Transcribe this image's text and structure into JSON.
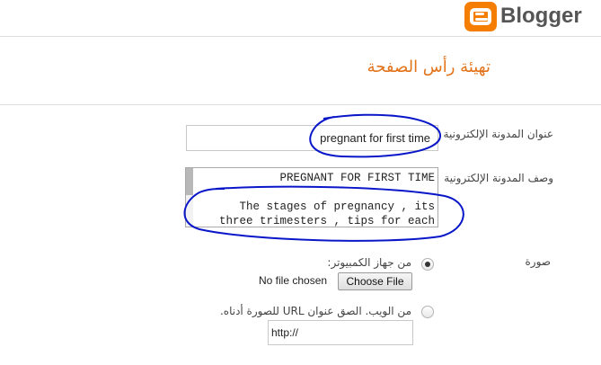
{
  "header": {
    "brand": "Blogger",
    "logo": "blogger-logo-icon"
  },
  "page": {
    "title": "تهيئة رأس الصفحة"
  },
  "form": {
    "blog_title_label": "عنوان المدونة الإلكترونية",
    "blog_title_value": "pregnant for first time",
    "description_label": "وصف المدونة الإلكترونية",
    "description_value": "PREGNANT FOR FIRST TIME\n\n    The stages of pregnancy , its\nthree trimesters , tips for each",
    "image_label": "صورة",
    "from_computer_label": "من جهاز الكمبيوتر:",
    "no_file_text": "No file chosen",
    "choose_file_label": "Choose File",
    "from_web_label": "من الويب. الصق عنوان URL للصورة أدناه.",
    "url_value": "http://",
    "selected_option": "from_computer"
  },
  "colors": {
    "brand_orange": "#f57d00",
    "title_orange": "#e2731a",
    "annotation_blue": "#0a17c8"
  }
}
